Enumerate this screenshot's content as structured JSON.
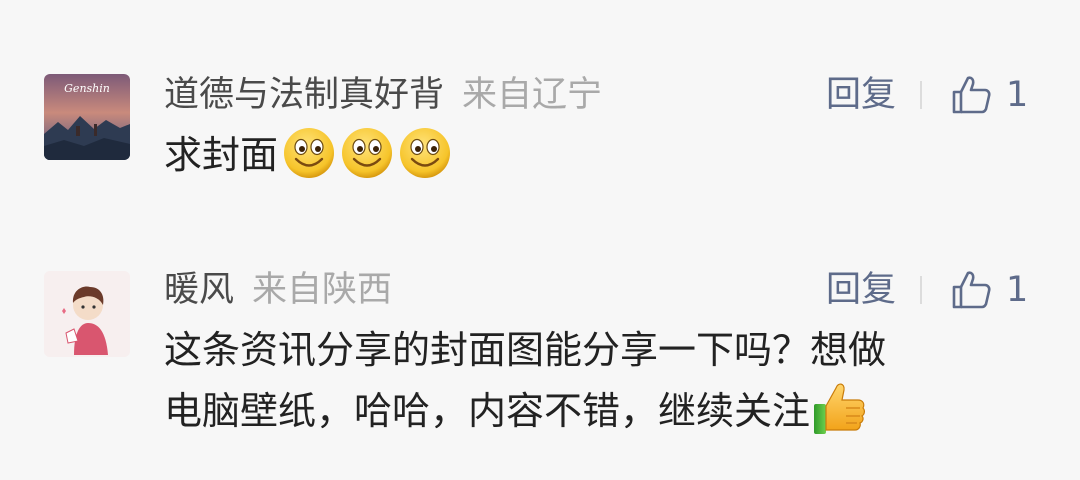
{
  "comments": [
    {
      "username": "道德与法制真好背",
      "location": "来自辽宁",
      "reply_label": "回复",
      "like_count": "1",
      "content": "求封面",
      "emojis": [
        "smile-emoji",
        "smile-emoji",
        "smile-emoji"
      ],
      "avatar_text": "Genshin"
    },
    {
      "username": "暖风",
      "location": "来自陕西",
      "reply_label": "回复",
      "like_count": "1",
      "content_line1": "这条资讯分享的封面图能分享一下吗？想做",
      "content_line2": "电脑壁纸，哈哈，内容不错，继续关注",
      "emojis": [
        "thumbs-up-emoji"
      ]
    }
  ],
  "colors": {
    "background": "#f7f7f7",
    "username": "#4a4a4a",
    "location": "#a9a9a9",
    "action": "#5e6b8a",
    "content": "#222222"
  }
}
